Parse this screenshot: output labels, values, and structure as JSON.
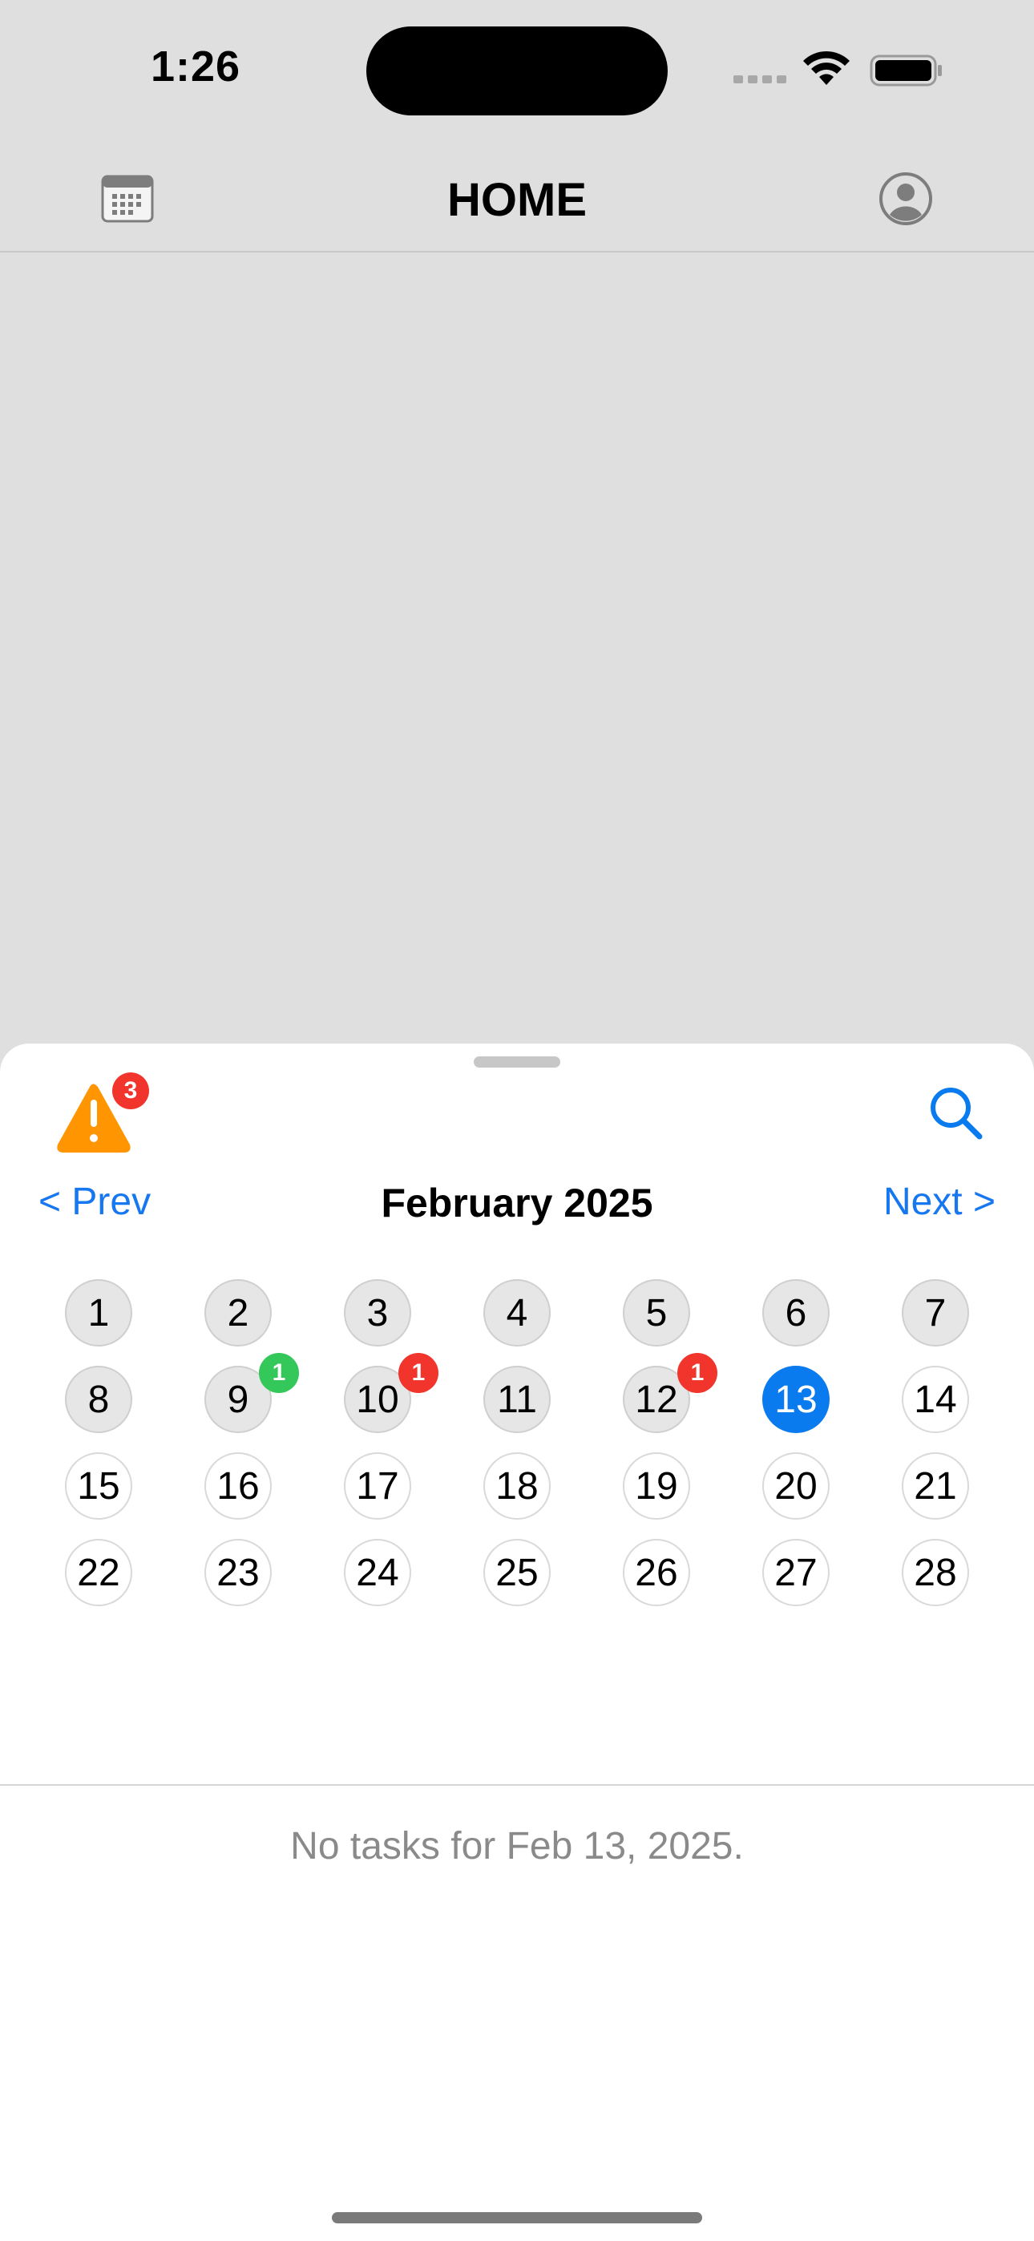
{
  "status_bar": {
    "time": "1:26"
  },
  "nav": {
    "title": "HOME",
    "left_icon": "calendar-icon",
    "right_icon": "profile-icon"
  },
  "sheet": {
    "warning_icon": "warning-icon",
    "warning_count": "3",
    "search_icon": "search-icon",
    "prev_label": "< Prev",
    "month_label": "February 2025",
    "next_label": "Next >",
    "selected_day": 13,
    "days": [
      {
        "label": "1",
        "state": "past"
      },
      {
        "label": "2",
        "state": "past"
      },
      {
        "label": "3",
        "state": "past"
      },
      {
        "label": "4",
        "state": "past"
      },
      {
        "label": "5",
        "state": "past"
      },
      {
        "label": "6",
        "state": "past"
      },
      {
        "label": "7",
        "state": "past"
      },
      {
        "label": "8",
        "state": "past"
      },
      {
        "label": "9",
        "state": "past",
        "badge": "1",
        "badge_color": "#34c759"
      },
      {
        "label": "10",
        "state": "past",
        "badge": "1",
        "badge_color": "#f2352c"
      },
      {
        "label": "11",
        "state": "past"
      },
      {
        "label": "12",
        "state": "past",
        "badge": "1",
        "badge_color": "#f2352c"
      },
      {
        "label": "13",
        "state": "selected"
      },
      {
        "label": "14",
        "state": "future"
      },
      {
        "label": "15",
        "state": "future"
      },
      {
        "label": "16",
        "state": "future"
      },
      {
        "label": "17",
        "state": "future"
      },
      {
        "label": "18",
        "state": "future"
      },
      {
        "label": "19",
        "state": "future"
      },
      {
        "label": "20",
        "state": "future"
      },
      {
        "label": "21",
        "state": "future"
      },
      {
        "label": "22",
        "state": "future"
      },
      {
        "label": "23",
        "state": "future"
      },
      {
        "label": "24",
        "state": "future"
      },
      {
        "label": "25",
        "state": "future"
      },
      {
        "label": "26",
        "state": "future"
      },
      {
        "label": "27",
        "state": "future"
      },
      {
        "label": "28",
        "state": "future"
      }
    ],
    "empty_message": "No tasks for Feb 13, 2025."
  },
  "colors": {
    "accent": "#0a7aef",
    "warning": "#ff9500",
    "alert_badge": "#f2352c",
    "success_badge": "#34c759"
  }
}
